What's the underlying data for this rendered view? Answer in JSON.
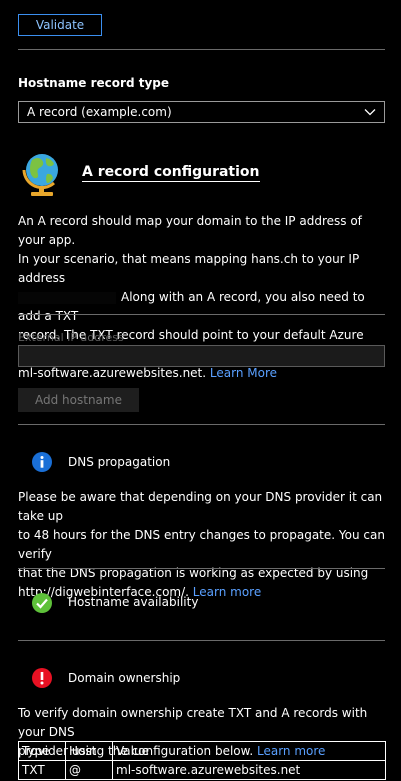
{
  "validate_button": "Validate",
  "record_type": {
    "label": "Hostname record type",
    "selected": "A record (example.com)"
  },
  "a_record": {
    "heading": "A record configuration",
    "line1": "An A record should map your domain to the IP address of your app.",
    "line2": "In your scenario, that means mapping hans.ch to your IP address",
    "line3": "Along with an A record, you also need to add a TXT",
    "line4": "record. The TXT record should point to your default Azure domain,",
    "line5": "ml-software.azurewebsites.net.",
    "learn_more": "Learn More"
  },
  "external_ip": {
    "placeholder": "External IP address",
    "value": ""
  },
  "add_hostname_button": "Add hostname",
  "dns_propagation": {
    "title": "DNS propagation",
    "line1": "Please be aware that depending on your DNS provider it can take up",
    "line2": "to 48 hours for the DNS entry changes to propagate. You can verify",
    "line3": "that the DNS propagation is working as expected by using",
    "line4": "http://digwebinterface.com/.",
    "learn_more": "Learn more"
  },
  "hostname_availability": {
    "title": "Hostname availability"
  },
  "domain_ownership": {
    "title": "Domain ownership",
    "line1": "To verify domain ownership create TXT and A records with your DNS",
    "line2": "provider using the configuration below.",
    "learn_more": "Learn more",
    "table": {
      "headers": [
        "Type",
        "Host",
        "Value"
      ],
      "rows": [
        [
          "TXT",
          "@",
          "ml-software.azurewebsites.net"
        ]
      ]
    }
  },
  "colors": {
    "accent": "#3b8ff0",
    "link": "#5aa0ff",
    "info": "#1a6fd6",
    "success": "#5ec13a",
    "error": "#e81123"
  },
  "icons": [
    "globe-icon",
    "chevron-down-icon",
    "info-icon",
    "checkmark-icon",
    "error-icon"
  ]
}
